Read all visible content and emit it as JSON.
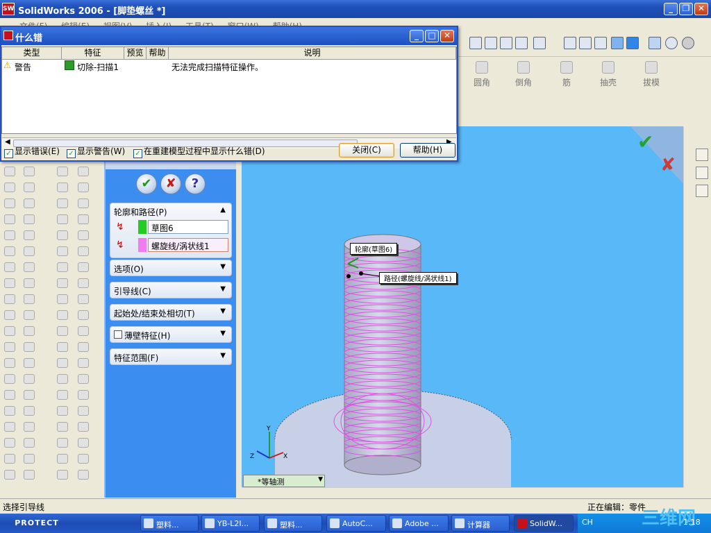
{
  "window": {
    "title": "SolidWorks 2006 - [脚垫螺丝 *]",
    "logo_text": "SW"
  },
  "menubar": [
    "文件(F)",
    "编辑(E)",
    "视图(V)",
    "插入(I)",
    "工具(T)",
    "窗口(W)",
    "帮助(H)"
  ],
  "features": [
    "圆角",
    "倒角",
    "筋",
    "抽壳",
    "拔模"
  ],
  "dialog": {
    "title": "什么错",
    "columns": [
      "类型",
      "特征",
      "预览",
      "帮助",
      "说明"
    ],
    "row": {
      "type": "警告",
      "feature": "切除-扫描1",
      "preview": "",
      "help": "",
      "desc": "无法完成扫描特征操作。"
    },
    "checkboxes": [
      "显示错误(E)",
      "显示警告(W)",
      "在重建模型过程中显示什么错(D)"
    ],
    "buttons": {
      "close": "关闭(C)",
      "help": "帮助(H)"
    }
  },
  "property_manager": {
    "groups": {
      "profile_path": "轮廓和路径(P)",
      "options": "选项(O)",
      "guide": "引导线(C)",
      "tangency": "起始处/结束处相切(T)",
      "thin": "薄壁特征(H)",
      "scope": "特征范围(F)"
    },
    "profile_value": "草图6",
    "path_value": "螺旋线/涡状线1",
    "profile_color": "#22cc22",
    "path_color": "#f07cf0"
  },
  "viewport": {
    "label_profile": "轮廓(草图6)",
    "label_path": "路径(螺旋线/涡状线1)",
    "view_name": "*等轴测",
    "axes": {
      "x": "X",
      "y": "Y",
      "z": "Z"
    }
  },
  "status": {
    "left": "选择引导线",
    "right": "正在编辑：零件"
  },
  "taskbar": {
    "start": "PROTECT",
    "items": [
      "塑料...",
      "YB-L2I...",
      "塑料...",
      "AutoC...",
      "Adobe ...",
      "计算器",
      "SolidW..."
    ],
    "tray_ime": "CH",
    "watermark": "三维网",
    "time": "1:18"
  }
}
